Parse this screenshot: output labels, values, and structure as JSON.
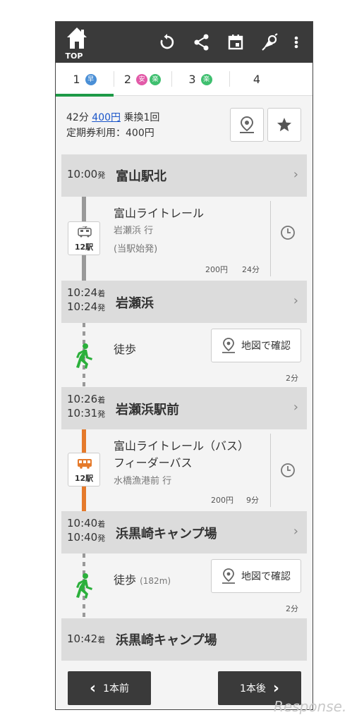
{
  "header": {
    "top_label": "TOP",
    "icons": [
      "refresh-icon",
      "share-icon",
      "calendar-icon",
      "alarm-icon",
      "more-vert-icon"
    ]
  },
  "tabs": [
    {
      "num": "1",
      "badges": [
        {
          "text": "早",
          "color": "#4a8fd6"
        }
      ]
    },
    {
      "num": "2",
      "badges": [
        {
          "text": "安",
          "color": "#e25aa8"
        },
        {
          "text": "楽",
          "color": "#3fbf6f"
        }
      ]
    },
    {
      "num": "3",
      "badges": [
        {
          "text": "楽",
          "color": "#3fbf6f"
        }
      ]
    },
    {
      "num": "4",
      "badges": []
    }
  ],
  "summary": {
    "duration": "42分",
    "fare": "400円",
    "transfers": "乗換1回",
    "commuter": "定期券利用：400円"
  },
  "stations": [
    {
      "arr": "",
      "dep": "10:00",
      "name": "富山駅北"
    },
    {
      "arr": "10:24",
      "dep": "10:24",
      "name": "岩瀬浜"
    },
    {
      "arr": "10:26",
      "dep": "10:31",
      "name": "岩瀬浜駅前"
    },
    {
      "arr": "10:40",
      "dep": "10:40",
      "name": "浜黒崎キャンプ場"
    },
    {
      "arr": "10:42",
      "dep": "",
      "name": "浜黒崎キャンプ場"
    }
  ],
  "labels": {
    "arr_suffix": "着",
    "dep_suffix": "発",
    "map_button": "地図で確認",
    "prev": "1本前",
    "next": "1本後"
  },
  "segments": {
    "train1": {
      "line": "富山ライトレール",
      "dest": "岩瀬浜 行",
      "note": "(当駅始発)",
      "fare": "200円",
      "time": "24分",
      "stops": "12駅",
      "color": "#999999"
    },
    "walk1": {
      "label": "徒歩",
      "dist": "",
      "time": "2分"
    },
    "bus1": {
      "line1": "富山ライトレール（バス）",
      "line2": "フィーダーバス",
      "dest": "水橋漁港前 行",
      "fare": "200円",
      "time": "9分",
      "stops": "12駅",
      "color": "#e57a2b"
    },
    "walk2": {
      "label": "徒歩",
      "dist": "(182m)",
      "time": "2分"
    }
  },
  "watermark": "Response."
}
